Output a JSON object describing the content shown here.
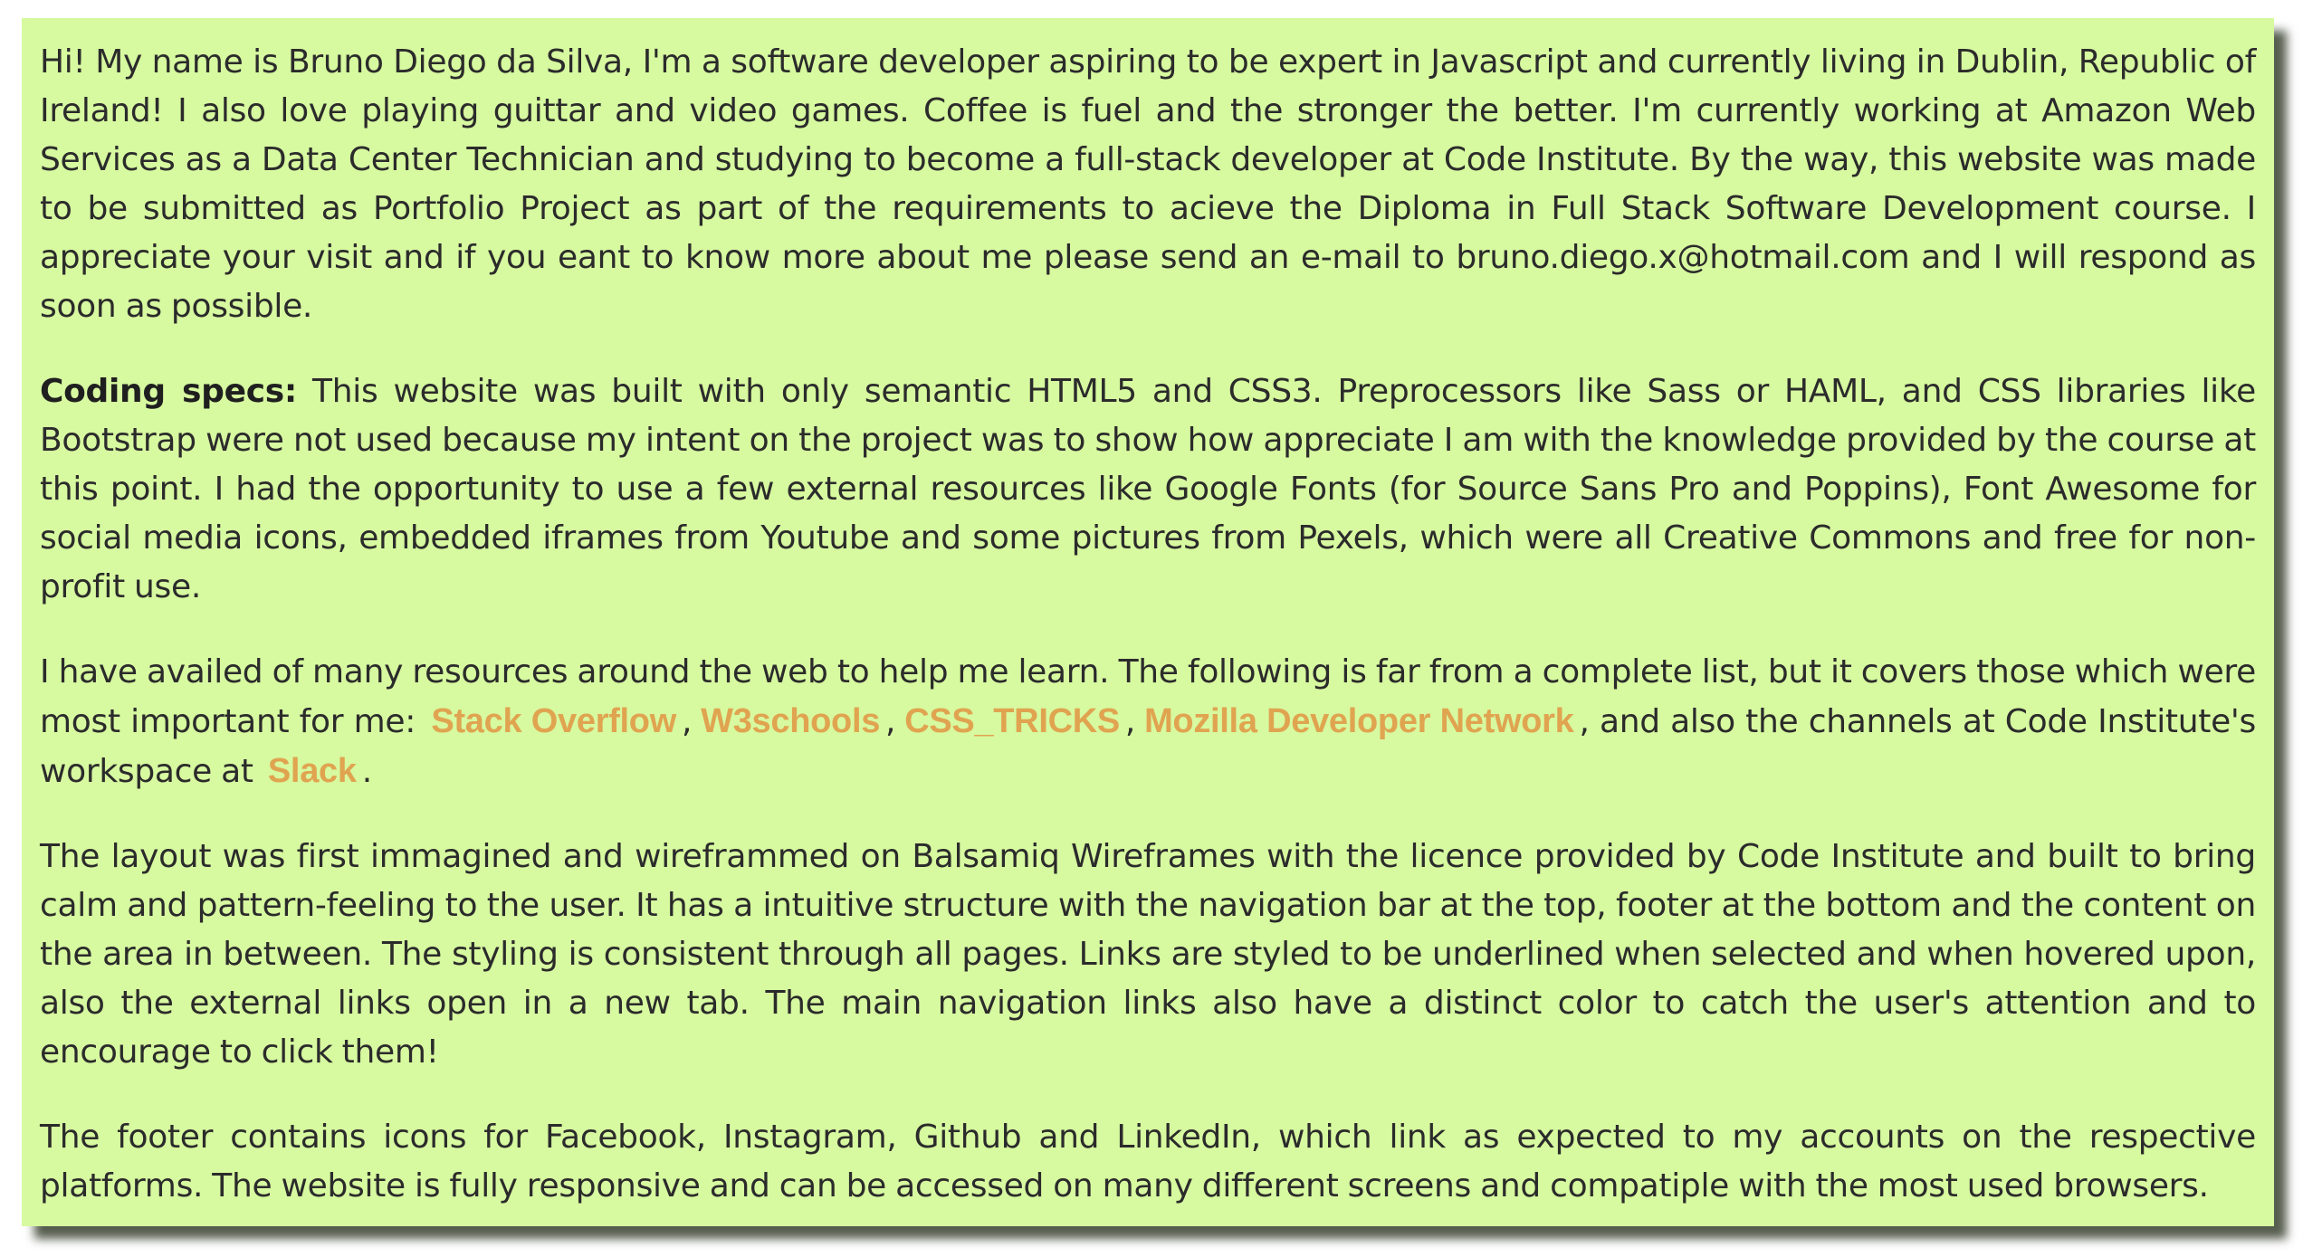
{
  "about": {
    "intro": "Hi! My name is Bruno Diego da Silva, I'm a software developer aspiring to be expert in Javascript and currently living in Dublin, Republic of Ireland! I also love playing guittar and video games. Coffee is fuel and the stronger the better. I'm currently working at Amazon Web Services as a Data Center Technician and studying to become a full-stack developer at Code Institute. By the way, this website was made to be submitted as Portfolio Project as part of the requirements to acieve the Diploma in Full Stack Software Development course. I appreciate your visit and if you eant to know more about me please send an e-mail to bruno.diego.x@hotmail.com and I will respond as soon as possible.",
    "coding_label": "Coding specs:",
    "coding_text": " This website was built with only semantic HTML5 and CSS3. Preprocessors like Sass or HAML, and CSS libraries like Bootstrap were not used because my intent on the project was to show how appreciate I am with the knowledge provided by the course at this point. I had the opportunity to use a few external resources like Google Fonts (for Source Sans Pro and Poppins), Font Awesome for social media icons, embedded iframes from Youtube and some pictures from Pexels, which were all Creative Commons and free for non-profit use.",
    "resources_text": "I have availed of many resources around the web to help me learn. The following is far from a complete list, but it covers those which were most important for me: ",
    "links": {
      "stack_overflow": "Stack Overflow",
      "w3schools": "W3schools",
      "css_tricks": "CSS_TRICKS",
      "mdn": "Mozilla Developer Network",
      "slack": "Slack"
    },
    "comma": ",",
    "resources_mid": ", and also the channels at Code Institute's workspace at ",
    "resources_end": ".",
    "layout_text": "The layout was first immagined and wireframmed on Balsamiq Wireframes with the licence provided by Code Institute and built to bring calm and pattern-feeling to the user. It has a intuitive structure with the navigation bar at the top, footer at the bottom and the content on the area in between. The styling is consistent through all pages. Links are styled to be underlined when selected and when hovered upon, also the external links open in a new tab. The main navigation links also have a distinct color to catch the user's attention and to encourage to click them!",
    "footer_text": "The footer contains icons for Facebook, Instagram, Github and LinkedIn, which link as expected to my accounts on the respective platforms. The website is fully responsive and can be accessed on many different screens and compatiple with the most used browsers."
  },
  "colors": {
    "card_background": "#d7f9a0",
    "link": "#e0a450",
    "text": "#2b2b2b"
  }
}
